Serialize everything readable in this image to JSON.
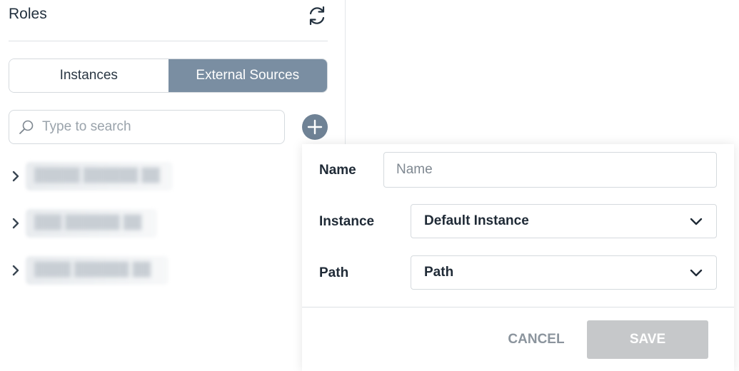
{
  "header": {
    "title": "Roles",
    "refresh_icon": "refresh-icon"
  },
  "tabs": [
    {
      "label": "Instances",
      "active": false
    },
    {
      "label": "External Sources",
      "active": true
    }
  ],
  "search": {
    "placeholder": "Type to search",
    "value": ""
  },
  "add_icon": "plus-icon",
  "tree": {
    "items": [
      {
        "label": "█████ ██████ ██"
      },
      {
        "label": "███ ██████ ██"
      },
      {
        "label": "████ ██████ ██"
      }
    ]
  },
  "form": {
    "name_label": "Name",
    "name_placeholder": "Name",
    "name_value": "",
    "instance_label": "Instance",
    "instance_value": "Default Instance",
    "path_label": "Path",
    "path_value": "Path",
    "cancel_label": "CANCEL",
    "save_label": "SAVE"
  },
  "colors": {
    "active_tab": "#7a8ea2",
    "add_button": "#6f8295",
    "save_disabled": "#c6c8ca"
  }
}
